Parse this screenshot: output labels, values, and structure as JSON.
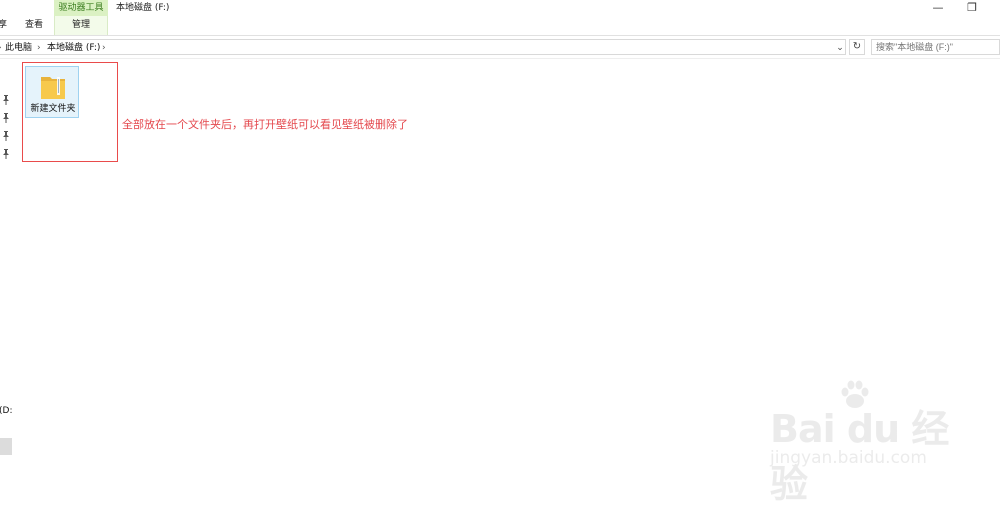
{
  "ribbon": {
    "tab_partial": "享",
    "tab_view": "查看",
    "context_group": "驱动器工具",
    "tab_manage": "管理",
    "window_title": "本地磁盘 (F:)",
    "minimize_glyph": "—",
    "restore_glyph": "❐"
  },
  "address_bar": {
    "crumbs": [
      "此电脑",
      "本地磁盘 (F:)"
    ],
    "separator": "›",
    "dropdown_glyph": "⌄",
    "refresh_glyph": "↻"
  },
  "search": {
    "placeholder": "搜索\"本地磁盘 (F:)\""
  },
  "nav_pane": {
    "pin_glyph": "📌",
    "drive_partial": "(D:"
  },
  "content": {
    "items": [
      {
        "label": "新建文件夹",
        "icon": "folder-icon"
      }
    ],
    "annotation": "全部放在一个文件夹后，再打开壁纸可以看见壁纸被删除了"
  },
  "watermark": {
    "brand": "Bai du 经验",
    "site": "jingyan.baidu.com"
  },
  "colors": {
    "context_tab_bg": "#dbf1c3",
    "annotation_red": "#e4474c",
    "selection_bg": "#e5f3fb",
    "folder_yellow": "#f7c94c"
  }
}
